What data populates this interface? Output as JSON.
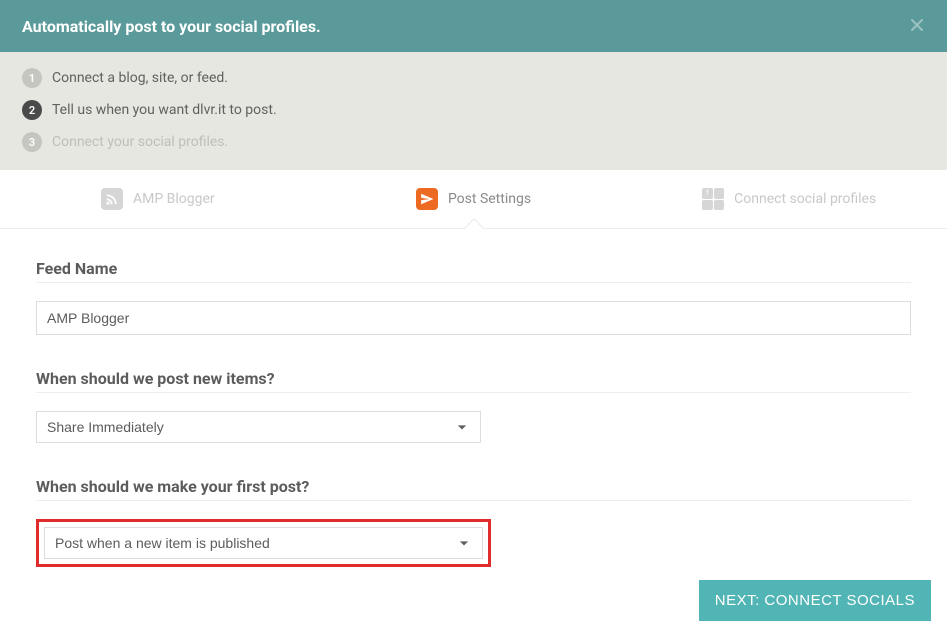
{
  "header": {
    "title": "Automatically post to your social profiles."
  },
  "steps": [
    {
      "num": "1",
      "text": "Connect a blog, site, or feed.",
      "state": "done"
    },
    {
      "num": "2",
      "text": "Tell us when you want dlvr.it to post.",
      "state": "active"
    },
    {
      "num": "3",
      "text": "Connect your social profiles.",
      "state": "todo"
    }
  ],
  "tabs": {
    "feed": {
      "label": "AMP Blogger"
    },
    "settings": {
      "label": "Post Settings"
    },
    "connect": {
      "label": "Connect social profiles"
    }
  },
  "form": {
    "feed_name_label": "Feed Name",
    "feed_name_value": "AMP Blogger",
    "post_when_label": "When should we post new items?",
    "post_when_value": "Share Immediately",
    "first_post_label": "When should we make your first post?",
    "first_post_value": "Post when a new item is published"
  },
  "buttons": {
    "next": "NEXT: CONNECT SOCIALS"
  }
}
